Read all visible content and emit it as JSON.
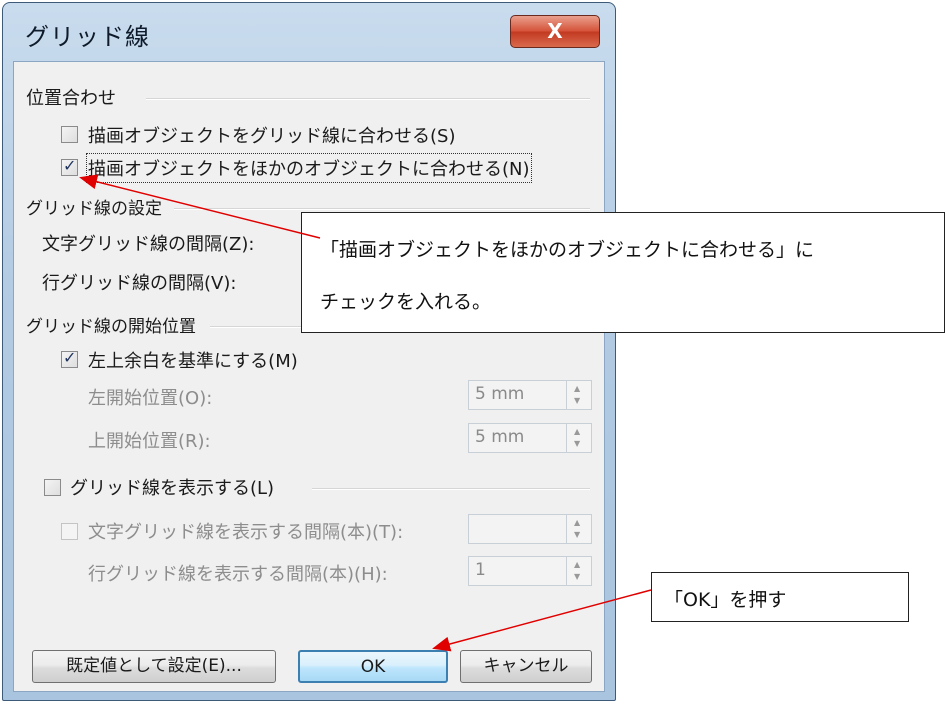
{
  "dialog": {
    "title": "グリッド線",
    "close_label": "X",
    "alignment": {
      "heading": "位置合わせ",
      "snap_to_grid": "描画オブジェクトをグリッド線に合わせる(S)",
      "snap_to_objects": "描画オブジェクトをほかのオブジェクトに合わせる(N)"
    },
    "grid_settings": {
      "heading": "グリッド線の設定",
      "char_spacing_label": "文字グリッド線の間隔(Z):",
      "line_spacing_label": "行グリッド線の間隔(V):"
    },
    "grid_origin": {
      "heading": "グリッド線の開始位置",
      "use_margins": "左上余白を基準にする(M)",
      "horizontal_label": "左開始位置(O):",
      "horizontal_value": "5 mm",
      "vertical_label": "上開始位置(R):",
      "vertical_value": "5 mm"
    },
    "display": {
      "show_grid": "グリッド線を表示する(L)",
      "char_every_label": "文字グリッド線を表示する間隔(本)(T):",
      "char_every_value": "",
      "line_every_label": "行グリッド線を表示する間隔(本)(H):",
      "line_every_value": "1"
    },
    "buttons": {
      "set_default": "既定値として設定(E)...",
      "ok": "OK",
      "cancel": "キャンセル"
    }
  },
  "annotations": {
    "callout_snap_line1": "「描画オブジェクトをほかのオブジェクトに合わせる」に",
    "callout_snap_line2": "チェックを入れる。",
    "callout_ok": "「OK」を押す"
  },
  "icons": {
    "checkbox_checked": "checkmark-icon",
    "spinner": "spin-arrows-icon",
    "close": "close-icon"
  },
  "colors": {
    "close_button": "#d5543a",
    "arrow": "#e00000",
    "default_button_border": "#3c7fb1"
  }
}
